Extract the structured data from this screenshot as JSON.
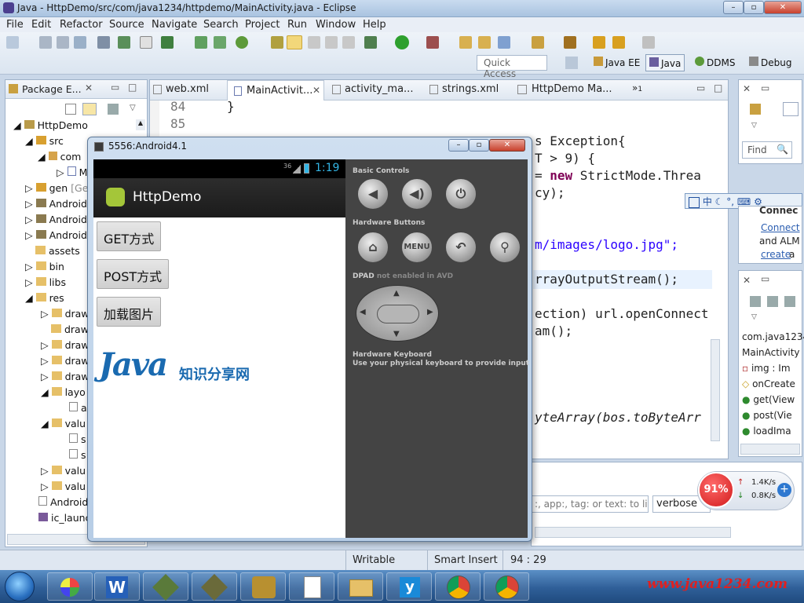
{
  "window": {
    "title": "Java - HttpDemo/src/com/java1234/httpdemo/MainActivity.java - Eclipse"
  },
  "menu": [
    "File",
    "Edit",
    "Refactor",
    "Source",
    "Navigate",
    "Search",
    "Project",
    "Run",
    "Window",
    "Help"
  ],
  "toolbar": {
    "quick_access": "Quick Access",
    "perspectives": [
      "Java EE",
      "Java",
      "DDMS",
      "Debug"
    ]
  },
  "package_explorer": {
    "tab_label": "Package E...",
    "items": [
      "HttpDemo",
      "src",
      "com",
      "M",
      "gen",
      "[Ge",
      "Android",
      "Android",
      "Android",
      "assets",
      "bin",
      "libs",
      "res",
      "draw",
      "draw",
      "draw",
      "draw",
      "draw",
      "layo",
      "a",
      "valu",
      "s",
      "s",
      "valu",
      "valu",
      "Android",
      "ic_launc"
    ]
  },
  "editor": {
    "tabs": [
      "web.xml",
      "MainActivit...",
      "activity_ma...",
      "strings.xml",
      "HttpDemo Ma..."
    ],
    "overflow_count": "1",
    "line_numbers": [
      "84",
      "85"
    ],
    "code": {
      "l84": "}",
      "l_exc": "s Exception{",
      "l_t9": "T > 9) {",
      "l_strict_eq": "= ",
      "l_strict_new": "new",
      "l_strict_rest": " StrictMode.Threa",
      "l_cy": "cy);",
      "l_logo": "m/images/logo.jpg\";",
      "l_aos": "rrayOutputStream();",
      "l_conn1": "ection) url.openConnect",
      "l_conn2": "am();",
      "l_bytes": "yteArray(bos.toByteArr"
    }
  },
  "emulator": {
    "title": "5556:Android4.1",
    "status_time": "1:19",
    "signal": "36",
    "app_title": "HttpDemo",
    "buttons": [
      "GET方式",
      "POST方式",
      "加载图片"
    ],
    "logo_java": "Java",
    "logo_text": "知识分享网",
    "controls": {
      "basic_label": "Basic Controls",
      "hardware_label": "Hardware Buttons",
      "dpad_label": "DPAD",
      "dpad_note": "not enabled in AVD",
      "keyboard_title": "Hardware Keyboard",
      "keyboard_desc": "Use your physical keyboard to provide input",
      "menu_label": "MENU"
    }
  },
  "right_panel": {
    "find": "Find",
    "connect_title": "Connec",
    "connect_link": "Connect",
    "connect_text": " and ALM",
    "create_link": "create",
    "create_text": " a",
    "outline_items": [
      "com.java1234",
      "MainActivity",
      "img : Im",
      "onCreate",
      "get(View",
      "post(Vie",
      "loadIma"
    ]
  },
  "logcat": {
    "filter_placeholder": ":, app:, tag: or text: to lin",
    "level": "verbose"
  },
  "ime": [
    "中"
  ],
  "net_widget": {
    "percent": "91%",
    "up": "1.4K/s",
    "down": "0.8K/s"
  },
  "status": {
    "writable": "Writable",
    "insert": "Smart Insert",
    "position": "94 : 29"
  },
  "taskbar": {
    "watermark": "www.java1234.com"
  }
}
